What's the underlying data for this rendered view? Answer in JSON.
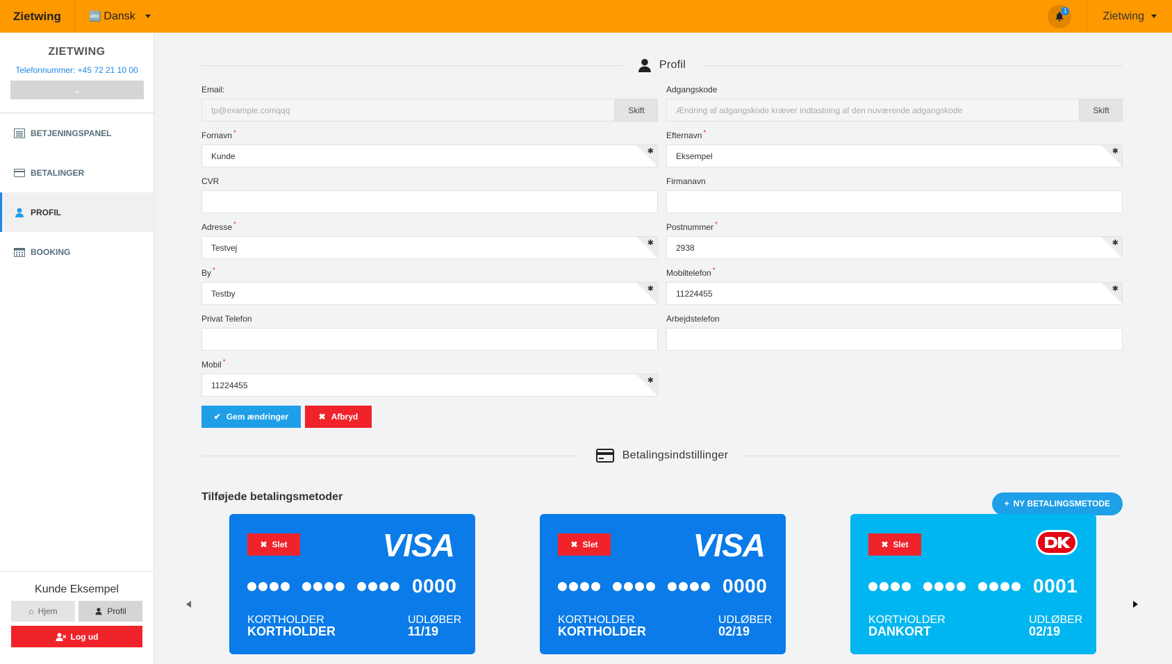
{
  "topbar": {
    "brand": "Zietwing",
    "language": "Dansk",
    "notification_count": "1",
    "user": "Zietwing"
  },
  "sidebar": {
    "company": "ZIETWING",
    "phone_label": "Telefonnummer:",
    "phone": "+45 72 21 10 00",
    "items": [
      {
        "label": "BETJENINGSPANEL",
        "icon": "dashboard-icon"
      },
      {
        "label": "BETALINGER",
        "icon": "credit-card-icon"
      },
      {
        "label": "PROFIL",
        "icon": "user-icon",
        "active": true
      },
      {
        "label": "BOOKING",
        "icon": "calendar-icon"
      }
    ],
    "user_name": "Kunde Eksempel",
    "home_label": "Hjem",
    "profile_label": "Profil",
    "logout_label": "Log ud"
  },
  "profile": {
    "title": "Profil",
    "email_label": "Email:",
    "email_value": "tp@example.comqqq",
    "password_label": "Adgangskode",
    "password_placeholder": "Ændring af adgangskode kræver indtastning af den nuværende adgangskode",
    "change_label": "Skift",
    "fields": {
      "fornavn": {
        "label": "Fornavn",
        "value": "Kunde"
      },
      "efternavn": {
        "label": "Efternavn",
        "value": "Eksempel"
      },
      "cvr": {
        "label": "CVR",
        "value": ""
      },
      "firmanavn": {
        "label": "Firmanavn",
        "value": ""
      },
      "adresse": {
        "label": "Adresse",
        "value": "Testvej"
      },
      "postnummer": {
        "label": "Postnummer",
        "value": "2938"
      },
      "by": {
        "label": "By",
        "value": "Testby"
      },
      "mobiltelefon": {
        "label": "Mobiltelefon",
        "value": "11224455"
      },
      "privat": {
        "label": "Privat Telefon",
        "value": ""
      },
      "arbejde": {
        "label": "Arbejdstelefon",
        "value": ""
      },
      "mobil": {
        "label": "Mobil",
        "value": "11224455"
      }
    },
    "save_label": "Gem ændringer",
    "cancel_label": "Afbryd"
  },
  "payment": {
    "title": "Betalingsindstillinger",
    "methods_title": "Tilføjede betalingsmetoder",
    "new_label": "NY BETALINGSMETODE",
    "delete_label": "Slet",
    "holder_caption": "KORTHOLDER",
    "expiry_caption": "UDLØBER",
    "cards": [
      {
        "brand": "VISA",
        "last4": "0000",
        "holder": "KORTHOLDER",
        "expiry": "11/19",
        "color": "#0a7be8"
      },
      {
        "brand": "VISA",
        "last4": "0000",
        "holder": "KORTHOLDER",
        "expiry": "02/19",
        "color": "#0a7be8"
      },
      {
        "brand": "Dankort",
        "last4": "0001",
        "holder": "DANKORT",
        "expiry": "02/19",
        "color": "#00b6f0"
      }
    ]
  },
  "colors": {
    "topbar": "#ff9900",
    "primary": "#1e9fe8",
    "danger": "#f0232b"
  }
}
